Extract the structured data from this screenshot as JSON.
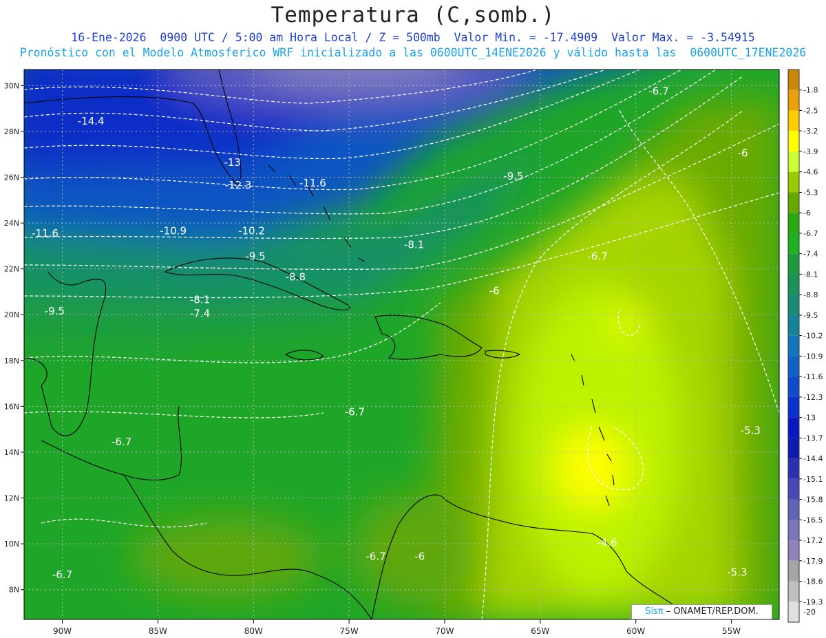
{
  "header": {
    "title": "Temperatura (C,somb.)",
    "line1": "16-Ene-2026  0900 UTC / 5:00 am Hora Local / Z = 500mb  Valor Min. = -17.4909  Valor Max. = -3.54915",
    "line2": "Pronóstico con el Modelo Atmosferico WRF inicializado a las 0600UTC_14ENE2026 y válido hasta las  0600UTC_17ENE2026"
  },
  "credit": {
    "brand": "Sisπ",
    "text": " – ONAMET/REP.DOM."
  },
  "colors": {
    "coast": "#000000",
    "grid": "#b8b8b8",
    "contour": "#ffffff"
  },
  "chart_data": {
    "type": "heatmap",
    "xlim": [
      -92,
      -52.5
    ],
    "ylim": [
      6.7,
      30.7
    ],
    "x_ticks": [
      {
        "value": -90,
        "label": "90W"
      },
      {
        "value": -85,
        "label": "85W"
      },
      {
        "value": -80,
        "label": "80W"
      },
      {
        "value": -75,
        "label": "75W"
      },
      {
        "value": -70,
        "label": "70W"
      },
      {
        "value": -65,
        "label": "65W"
      },
      {
        "value": -60,
        "label": "60W"
      },
      {
        "value": -55,
        "label": "55W"
      }
    ],
    "y_ticks": [
      {
        "value": 30,
        "label": "30N"
      },
      {
        "value": 28,
        "label": "28N"
      },
      {
        "value": 26,
        "label": "26N"
      },
      {
        "value": 24,
        "label": "24N"
      },
      {
        "value": 22,
        "label": "22N"
      },
      {
        "value": 20,
        "label": "20N"
      },
      {
        "value": 18,
        "label": "18N"
      },
      {
        "value": 16,
        "label": "16N"
      },
      {
        "value": 14,
        "label": "14N"
      },
      {
        "value": 12,
        "label": "12N"
      },
      {
        "value": 10,
        "label": "10N"
      },
      {
        "value": 8,
        "label": "8N"
      }
    ],
    "colorbar": {
      "levels": [
        {
          "label": "-1.8",
          "color": "#c8860a"
        },
        {
          "label": "-2.5",
          "color": "#eba10c"
        },
        {
          "label": "-3.2",
          "color": "#ffcc00"
        },
        {
          "label": "-3.9",
          "color": "#ffff00"
        },
        {
          "label": "-4.6",
          "color": "#ccff33"
        },
        {
          "label": "-5.3",
          "color": "#99cc00"
        },
        {
          "label": "-6",
          "color": "#66a800"
        },
        {
          "label": "-6.7",
          "color": "#2aa80f"
        },
        {
          "label": "-7.4",
          "color": "#1fb022"
        },
        {
          "label": "-8.1",
          "color": "#1c9d3c"
        },
        {
          "label": "-8.8",
          "color": "#1a9359"
        },
        {
          "label": "-9.5",
          "color": "#178b74"
        },
        {
          "label": "-10.2",
          "color": "#13839a"
        },
        {
          "label": "-10.9",
          "color": "#1077bf"
        },
        {
          "label": "-11.6",
          "color": "#0f63c6"
        },
        {
          "label": "-12.3",
          "color": "#0d4ccc"
        },
        {
          "label": "-13",
          "color": "#0a31cc"
        },
        {
          "label": "-13.7",
          "color": "#0718c2"
        },
        {
          "label": "-14.4",
          "color": "#0f1ab0"
        },
        {
          "label": "-15.1",
          "color": "#2a30b0"
        },
        {
          "label": "-15.8",
          "color": "#4848b8"
        },
        {
          "label": "-16.5",
          "color": "#6262b8"
        },
        {
          "label": "-17.2",
          "color": "#7b76b8"
        },
        {
          "label": "-17.9",
          "color": "#9181b8"
        },
        {
          "label": "-18.6",
          "color": "#a6a6a6"
        },
        {
          "label": "-19.3",
          "color": "#c0c0c0"
        },
        {
          "label": "-20",
          "color": "#e0e0e0"
        }
      ]
    },
    "contour_labels": [
      {
        "lon": -88.5,
        "lat": 28.3,
        "text": "-14.4"
      },
      {
        "lon": -81.1,
        "lat": 26.5,
        "text": "-13"
      },
      {
        "lon": -80.8,
        "lat": 25.5,
        "text": "-12.3"
      },
      {
        "lon": -76.9,
        "lat": 25.6,
        "text": "-11.6"
      },
      {
        "lon": -66.4,
        "lat": 25.9,
        "text": "-9.5"
      },
      {
        "lon": -90.9,
        "lat": 23.4,
        "text": "-11.6"
      },
      {
        "lon": -84.2,
        "lat": 23.5,
        "text": "-10.9"
      },
      {
        "lon": -80.1,
        "lat": 23.5,
        "text": "-10.2"
      },
      {
        "lon": -79.9,
        "lat": 22.4,
        "text": "-9.5"
      },
      {
        "lon": -71.6,
        "lat": 22.9,
        "text": "-8.1"
      },
      {
        "lon": -77.8,
        "lat": 21.5,
        "text": "-8.8"
      },
      {
        "lon": -62.0,
        "lat": 22.4,
        "text": "-6.7"
      },
      {
        "lon": -82.8,
        "lat": 20.5,
        "text": "-8.1"
      },
      {
        "lon": -82.8,
        "lat": 19.9,
        "text": "-7.4"
      },
      {
        "lon": -90.4,
        "lat": 20.0,
        "text": "-9.5"
      },
      {
        "lon": -67.4,
        "lat": 20.9,
        "text": "-6"
      },
      {
        "lon": -58.8,
        "lat": 29.6,
        "text": "-6.7"
      },
      {
        "lon": -54.4,
        "lat": 26.9,
        "text": "-6"
      },
      {
        "lon": -74.7,
        "lat": 15.6,
        "text": "-6.7"
      },
      {
        "lon": -86.9,
        "lat": 14.3,
        "text": "-6.7"
      },
      {
        "lon": -54.0,
        "lat": 14.8,
        "text": "-5.3"
      },
      {
        "lon": -90.0,
        "lat": 8.5,
        "text": "-6.7"
      },
      {
        "lon": -73.6,
        "lat": 9.3,
        "text": "-6.7"
      },
      {
        "lon": -71.3,
        "lat": 9.3,
        "text": "-6"
      },
      {
        "lon": -61.5,
        "lat": 9.9,
        "text": "-4.6"
      },
      {
        "lon": -54.7,
        "lat": 8.6,
        "text": "-5.3"
      }
    ]
  }
}
